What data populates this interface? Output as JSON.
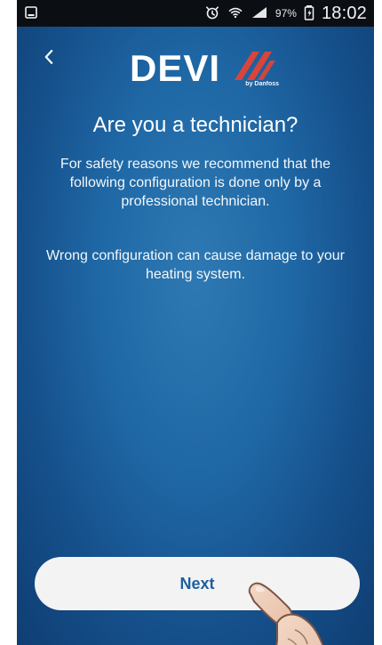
{
  "statusbar": {
    "battery_percent": "97%",
    "time": "18:02"
  },
  "header": {
    "logo_text": "DEVI",
    "logo_subtext": "by Danfoss"
  },
  "content": {
    "title": "Are you a technician?",
    "paragraph_1": "For safety reasons we recommend that the following configuration is done only by a professional technician.",
    "paragraph_2": "Wrong configuration can cause damage to your heating system."
  },
  "actions": {
    "next_label": "Next"
  },
  "icons": {
    "status_left": "screenshot-icon",
    "alarm": "alarm-clock-icon",
    "wifi": "wifi-icon",
    "signal": "cell-signal-icon",
    "battery": "battery-icon",
    "back": "chevron-left-icon",
    "hand": "pointing-hand-icon"
  },
  "colors": {
    "bg_top": "#2e79b3",
    "bg_bottom": "#0f3e73",
    "button_bg": "#f3f3f3",
    "button_text": "#1d5f9f",
    "logo_red": "#d9453b"
  }
}
